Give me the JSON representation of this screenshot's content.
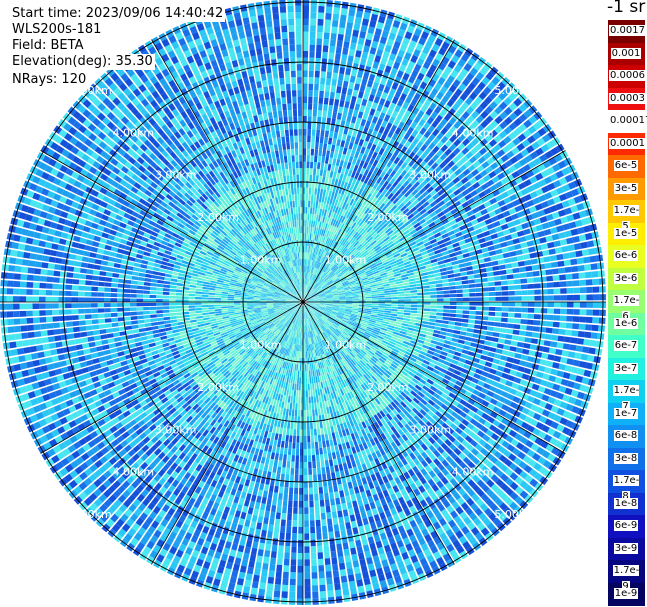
{
  "info": {
    "start_time": "Start time: 2023/09/06 14:40:42",
    "instrument": "WLS200s-181",
    "field": "Field: BETA",
    "elevation": "Elevation(deg): 35.30",
    "nrays": "NRays: 120"
  },
  "colorbar": {
    "unit": "-1 sr",
    "labels": [
      "0.0017",
      "0.001",
      "0.0006",
      "0.0003",
      "0.00017",
      "0.0001",
      "6e-5",
      "3e-5",
      "1.7e-5",
      "1e-5",
      "6e-6",
      "3e-6",
      "1.7e-6",
      "1e-6",
      "6e-7",
      "3e-7",
      "1.7e-7",
      "1e-7",
      "6e-8",
      "3e-8",
      "1.7e-8",
      "1e-8",
      "6e-9",
      "3e-9",
      "1.7e-9",
      "1e-9"
    ],
    "colors": [
      "#7a0000",
      "#aa0000",
      "#cc0000",
      "#ee1010",
      "#ffffff",
      "#ff2a00",
      "#ff6a00",
      "#ff9a00",
      "#ffc800",
      "#ffee00",
      "#e8ff20",
      "#c0ff40",
      "#98ff70",
      "#70ffa0",
      "#40ffc8",
      "#20f0e0",
      "#10d0f0",
      "#10b0f8",
      "#1090f0",
      "#1070e8",
      "#1050e0",
      "#1030d0",
      "#1010c0",
      "#0a0aa0",
      "#060680",
      "#040460"
    ]
  },
  "chart_data": {
    "type": "polar-ppi",
    "field": "BETA",
    "n_rays": 120,
    "range_rings_km": [
      1,
      2,
      3,
      4,
      5
    ],
    "ring_labels": [
      "1.00km",
      "2.00km",
      "3.00km",
      "4.00km",
      "5.00km"
    ],
    "max_range_km": 5.0,
    "dominant_value_far": "1e-8 to 1e-7",
    "dominant_value_near": "1e-7 to 1e-6",
    "colors": {
      "far": [
        "#1a6fe8",
        "#1ea0f0",
        "#2bc8f5",
        "#1450d8",
        "#48e6f0"
      ],
      "near": [
        "#2fe0e8",
        "#20c4f0",
        "#5ef0d8",
        "#1fa8f0",
        "#7af5d0"
      ]
    }
  }
}
